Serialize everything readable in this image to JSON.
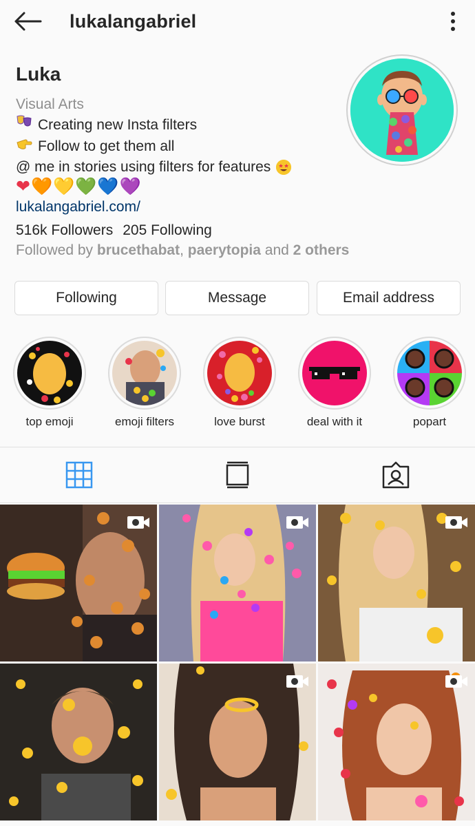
{
  "header": {
    "username": "lukalangabriel"
  },
  "profile": {
    "display_name": "Luka",
    "category": "Visual Arts",
    "bio": {
      "line1": "Creating new Insta filters",
      "line2": "Follow to get them all",
      "line3": "@ me in stories using filters for features",
      "hearts": [
        "❤",
        "🧡",
        "💛",
        "💚",
        "💙",
        "💜"
      ]
    },
    "website": "lukalangabriel.com/",
    "stats": {
      "followers": "516k Followers",
      "following": "205 Following"
    },
    "followed_by": {
      "prefix": "Followed by ",
      "user1": "brucethabat",
      "sep": ", ",
      "user2": "paerytopia",
      "mid": " and ",
      "others": "2 others"
    }
  },
  "actions": {
    "following": "Following",
    "message": "Message",
    "email": "Email address"
  },
  "highlights": [
    {
      "label": "top emoji"
    },
    {
      "label": "emoji filters"
    },
    {
      "label": "love burst"
    },
    {
      "label": "deal with it"
    },
    {
      "label": "popart"
    }
  ],
  "tabs": [
    "grid-icon",
    "igtv-icon",
    "tagged-icon"
  ],
  "posts": [
    {
      "type": "video"
    },
    {
      "type": "video"
    },
    {
      "type": "video"
    },
    {
      "type": "image"
    },
    {
      "type": "video"
    },
    {
      "type": "video"
    }
  ],
  "colors": {
    "text": "#262626",
    "secondary": "#8e8e8e",
    "link": "#003569",
    "active_tab": "#3897f0",
    "border": "#dbdbdb"
  }
}
